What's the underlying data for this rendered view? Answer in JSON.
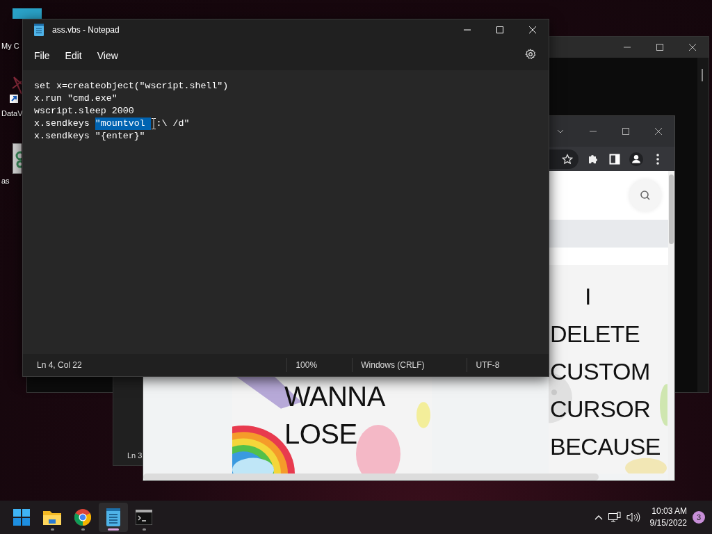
{
  "desktop_icons": [
    {
      "kind": "monitor",
      "label": "My C"
    },
    {
      "kind": "shortcut",
      "label": "DataV"
    },
    {
      "kind": "script",
      "label": "as"
    }
  ],
  "back_notepad": {
    "status": "Ln 3"
  },
  "browser": {
    "page": {
      "card_1": {
        "lines": [
          "WANNA",
          "LOSE"
        ]
      },
      "card_2": {
        "lines": [
          "I",
          "DELETE",
          "CUSTOM",
          "CURSOR",
          "BECAUSE"
        ]
      }
    }
  },
  "notepad": {
    "title": "ass.vbs - Notepad",
    "menu": [
      "File",
      "Edit",
      "View"
    ],
    "lines": [
      {
        "text": "set x=createobject(\"wscript.shell\")"
      },
      {
        "text": "x.run \"cmd.exe\""
      },
      {
        "text": "wscript.sleep 2000"
      },
      {
        "text": "x.sendkeys ",
        "selection": "\"mountvol ",
        "after": ":\\ /d\""
      },
      {
        "text": "x.sendkeys \"{enter}\""
      }
    ],
    "status": [
      "Ln 4, Col 22",
      "100%",
      "Windows (CRLF)",
      "UTF-8"
    ]
  },
  "taskbar": {
    "apps": [
      {
        "kind": "start",
        "selected": false
      },
      {
        "kind": "folder",
        "selected": false
      },
      {
        "kind": "chrome",
        "selected": false
      },
      {
        "kind": "notepad",
        "selected": true
      },
      {
        "kind": "terminal",
        "selected": false
      }
    ],
    "time": "10:03 AM",
    "date": "9/15/2022",
    "notification_count": "3"
  }
}
